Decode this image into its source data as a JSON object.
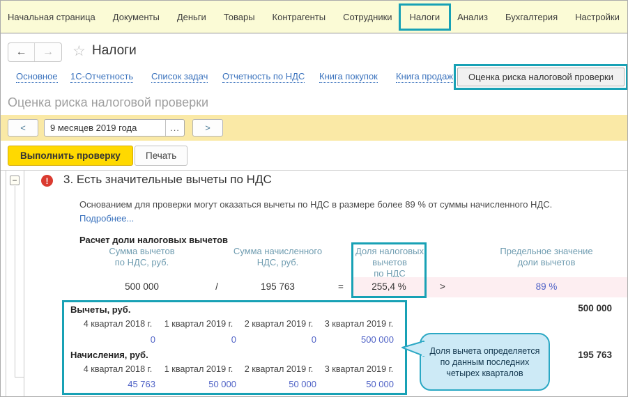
{
  "colors": {
    "accent_teal": "#18a1b5",
    "menu_bg": "#fbfbd6",
    "period_bar_bg": "#fae9a6",
    "primary_button_bg": "#ffd900",
    "link_blue": "#3a72bd",
    "value_blue": "#4f62c6",
    "pink_bg": "#fdeef1",
    "alert_red": "#da3b30",
    "table_header_teal": "#6f9cb0"
  },
  "menu": {
    "items": [
      "Начальная страница",
      "Документы",
      "Деньги",
      "Товары",
      "Контрагенты",
      "Сотрудники",
      "Налоги",
      "Анализ",
      "Бухгалтерия",
      "Настройки"
    ],
    "active_item": "Налоги"
  },
  "nav": {
    "back_glyph": "←",
    "forward_glyph": "→",
    "star_glyph": "☆",
    "title": "Налоги"
  },
  "tabs": {
    "items": [
      "Основное",
      "1С-Отчетность",
      "Список задач",
      "Отчетность по НДС",
      "Книга покупок",
      "Книга продаж"
    ],
    "risk_button_label": "Оценка риска налоговой проверки"
  },
  "section": {
    "title": "Оценка риска налоговой проверки"
  },
  "period": {
    "prev_label": "<",
    "value": "9 месяцев 2019 года",
    "ellipsis_label": "...",
    "next_label": ">"
  },
  "toolbar": {
    "run_label": "Выполнить проверку",
    "print_label": "Печать"
  },
  "finding": {
    "collapse_glyph": "−",
    "alert_glyph": "!",
    "title": "3. Есть значительные вычеты по НДС",
    "description": "Основанием для проверки могут оказаться вычеты по НДС в размере более 89 % от суммы начисленного НДС.",
    "more_link": "Подробнее...",
    "calc_title": "Расчет доли налоговых вычетов"
  },
  "calc": {
    "headers": [
      {
        "l1": "Сумма вычетов",
        "l2": "по НДС, руб."
      },
      {
        "l1": "Сумма начисленного",
        "l2": "НДС, руб."
      },
      {
        "l1": "Доля налоговых вычетов",
        "l2": "по НДС"
      },
      {
        "l1": "Предельное значение",
        "l2": "доли вычетов"
      }
    ],
    "deduction_sum": "500 000",
    "divide_sign": "/",
    "accrued_sum": "195 763",
    "equals_sign": "=",
    "share_value": "255,4 %",
    "greater_sign": ">",
    "limit_value": "89 %"
  },
  "quarters": {
    "deductions": {
      "label": "Вычеты, руб.",
      "columns": [
        "4 квартал 2018 г.",
        "1 квартал 2019 г.",
        "2 квартал 2019 г.",
        "3 квартал 2019 г."
      ],
      "values": [
        "0",
        "0",
        "0",
        "500 000"
      ],
      "total": "500 000"
    },
    "accruals": {
      "label": "Начисления, руб.",
      "columns": [
        "4 квартал 2018 г.",
        "1 квартал 2019 г.",
        "2 квартал 2019 г.",
        "3 квартал 2019 г."
      ],
      "values": [
        "45 763",
        "50 000",
        "50 000",
        "50 000"
      ],
      "total": "195 763"
    }
  },
  "callout": {
    "text": "Доля вычета определяется по данным последних четырех кварталов"
  }
}
